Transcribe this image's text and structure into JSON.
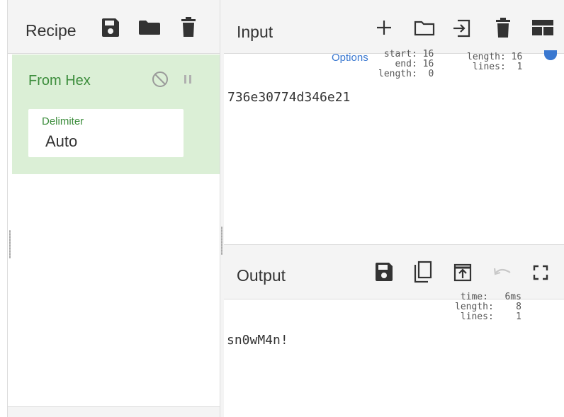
{
  "recipe": {
    "title": "Recipe",
    "icons": [
      "save-icon",
      "folder-icon",
      "trash-icon"
    ],
    "operation": {
      "name": "From Hex",
      "icons": [
        "disable-icon",
        "pause-icon"
      ],
      "arg_label": "Delimiter",
      "arg_value": "Auto"
    }
  },
  "input": {
    "title": "Input",
    "icons": [
      "plus-icon",
      "folder-outline-icon",
      "import-icon",
      "trash-icon",
      "layout-icon"
    ],
    "options_text": "Options",
    "stats_left": "start: 16\n  end: 16\nlength:  0",
    "stats_right": "length: 16\n lines:  1",
    "text": "736e30774d346e21"
  },
  "output": {
    "title": "Output",
    "icons": [
      "save-icon",
      "copy-icon",
      "replace-input-icon",
      "undo-icon",
      "maximize-icon"
    ],
    "stats": "time:   6ms\nlength:    8\nlines:    1",
    "text": "sn0wM4n!"
  },
  "colors": {
    "operation_bg": "#dbefd6",
    "operation_text": "#3c8d3c",
    "header_bg": "#f4f4f4",
    "link": "#3a78d0"
  }
}
